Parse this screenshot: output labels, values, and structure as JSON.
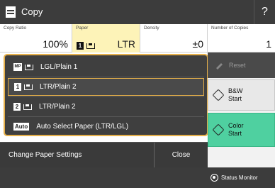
{
  "window": {
    "title": "Copy",
    "help_label": "?"
  },
  "settings": {
    "copy_ratio": {
      "label": "Copy Ratio",
      "value": "100%"
    },
    "paper": {
      "label": "Paper",
      "tray": "1",
      "size": "LTR"
    },
    "density": {
      "label": "Density",
      "value": "±0"
    },
    "copies": {
      "label": "Number of Copies",
      "value": "1"
    }
  },
  "paper_options": [
    {
      "badge": "MP",
      "label": "LGL/Plain 1",
      "selected": false
    },
    {
      "badge": "1",
      "label": "LTR/Plain 2",
      "selected": true
    },
    {
      "badge": "2",
      "label": "LTR/Plain 2",
      "selected": false
    },
    {
      "badge": "Auto",
      "label": "Auto Select Paper (LTR/LGL)",
      "selected": false
    }
  ],
  "bottom": {
    "change_label": "Change Paper Settings",
    "close_label": "Close"
  },
  "right": {
    "reset_label": "Reset",
    "bw_line1": "B&W",
    "bw_line2": "Start",
    "color_line1": "Color",
    "color_line2": "Start"
  },
  "status": {
    "label": "Status Monitor"
  },
  "colors": {
    "accent": "#e6b04a",
    "paper_highlight": "#fdf3b8",
    "color_start": "#4fd0a0"
  }
}
